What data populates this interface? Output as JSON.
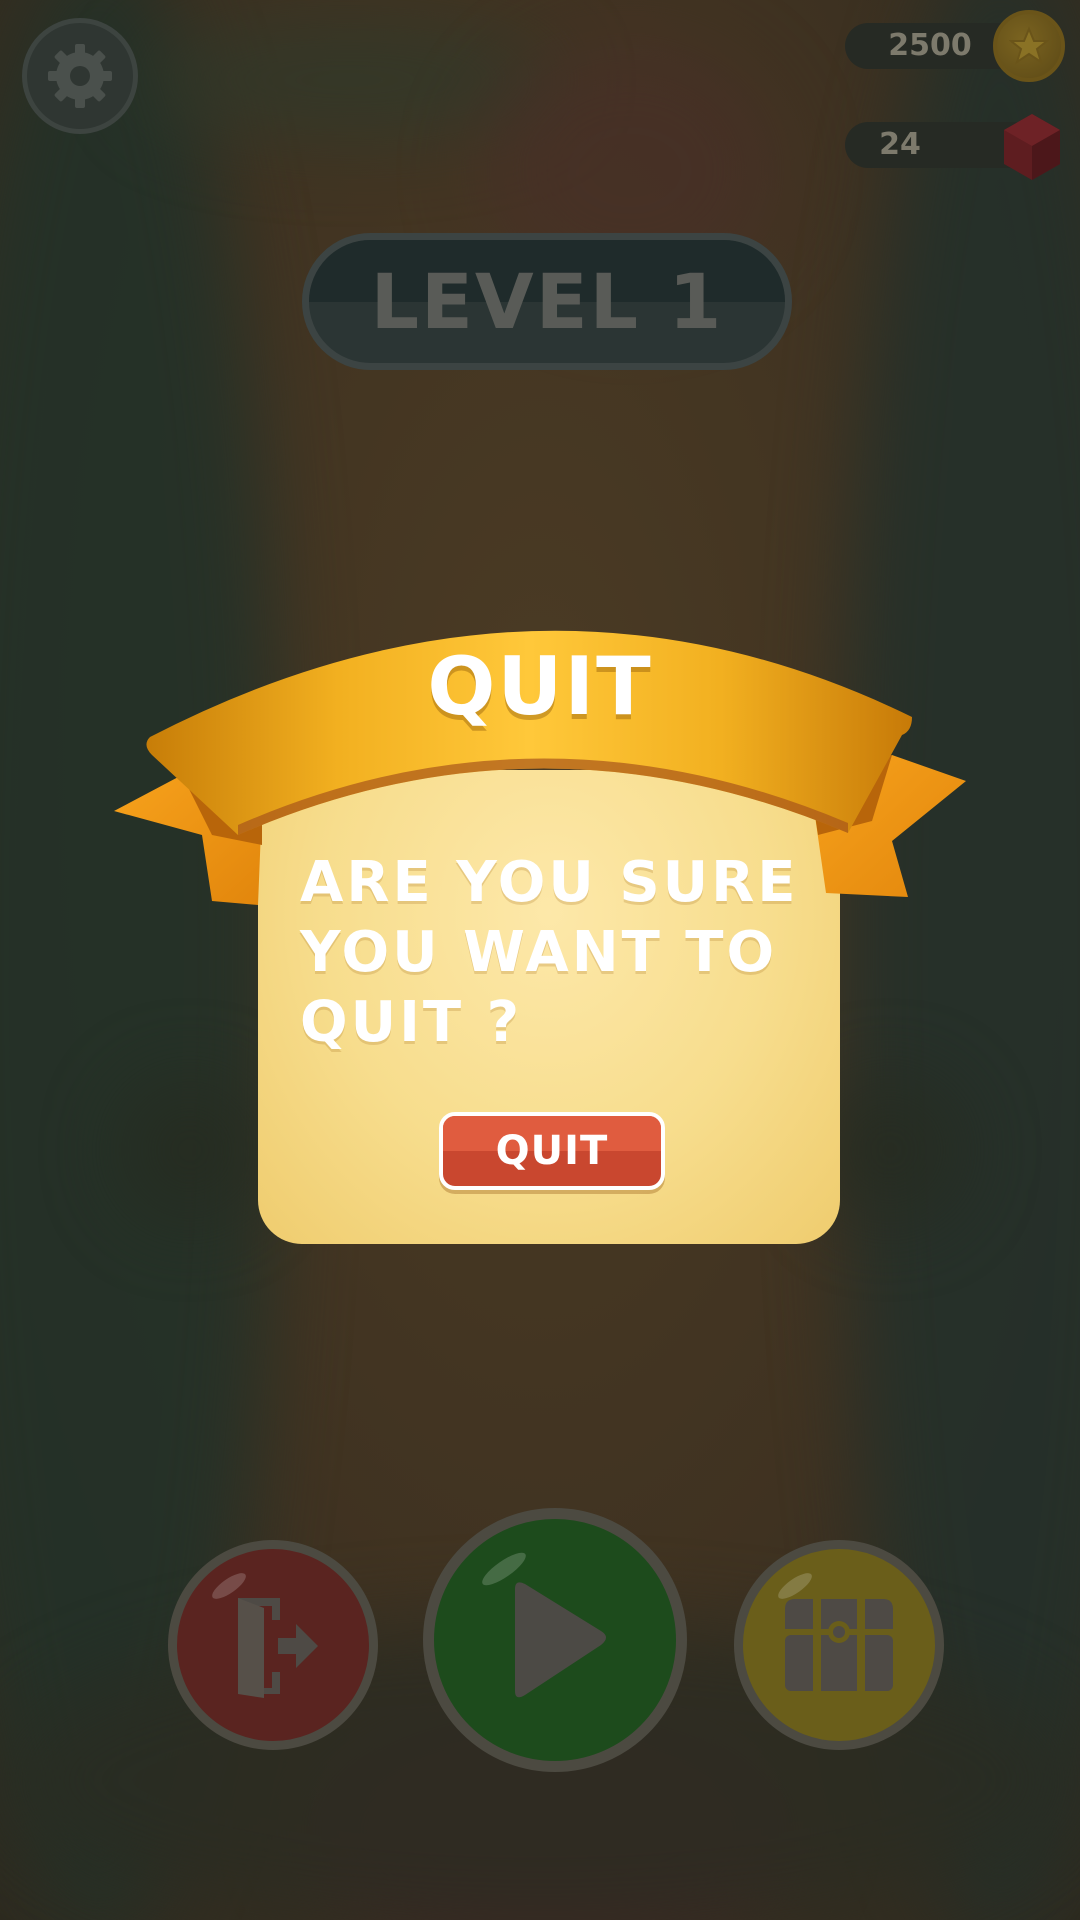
{
  "hud": {
    "coins": "2500",
    "gems": "24",
    "settings_icon": "gear-icon",
    "coin_icon": "star-coin-icon",
    "gem_icon": "ruby-gem-icon"
  },
  "level": {
    "label": "LEVEL 1"
  },
  "dialog": {
    "title": "QUIT",
    "message": "ARE YOU SURE YOU WANT TO QUIT ?",
    "confirm_label": "QUIT"
  },
  "bottom_bar": {
    "exit_icon": "exit-door-icon",
    "play_icon": "play-icon",
    "chest_icon": "treasure-chest-icon"
  },
  "colors": {
    "ribbon": "#f5a623",
    "card": "#fbe39c",
    "confirm_button": "#d9533a",
    "exit_button": "#5a2420",
    "play_button": "#1d4b1c",
    "chest_button": "#6a5e1a"
  }
}
